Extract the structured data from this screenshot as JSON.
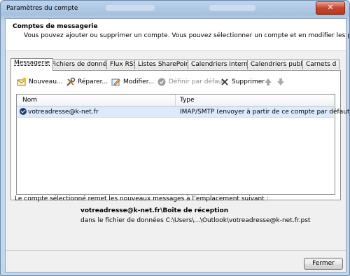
{
  "window": {
    "title": "Paramètres du compte",
    "close_glyph": "✕"
  },
  "header": {
    "title": "Comptes de messagerie",
    "description": "Vous pouvez ajouter ou supprimer un compte. Vous pouvez sélectionner un compte et en modifier les paramètres."
  },
  "tabs": [
    {
      "label": "Messagerie"
    },
    {
      "label": "Fichiers de données"
    },
    {
      "label": "Flux RSS"
    },
    {
      "label": "Listes SharePoint"
    },
    {
      "label": "Calendriers Internet"
    },
    {
      "label": "Calendriers publiés"
    },
    {
      "label": "Carnets d"
    }
  ],
  "toolbar": {
    "new": "Nouveau...",
    "repair": "Réparer...",
    "modify": "Modifier...",
    "set_default": "Définir par défaut",
    "delete": "Supprimer"
  },
  "accounts_table": {
    "columns": [
      "Nom",
      "Type"
    ],
    "rows": [
      {
        "name": "votreadresse@k-net.fr",
        "type": "IMAP/SMTP (envoyer à partir de ce compte par défaut)"
      }
    ]
  },
  "delivery": {
    "intro": "Le compte sélectionné remet les nouveaux messages à l’emplacement suivant :",
    "location": "votreadresse@k-net.fr\\Boîte de réception",
    "datafile": "dans le fichier de données C:\\Users\\...\\Outlook\\votreadresse@k-net.fr.pst"
  },
  "footer": {
    "close_label": "Fermer"
  },
  "colors": {
    "selection": "#dcebfc",
    "titlebar": "#a7c1dd",
    "close": "#c7432b"
  }
}
